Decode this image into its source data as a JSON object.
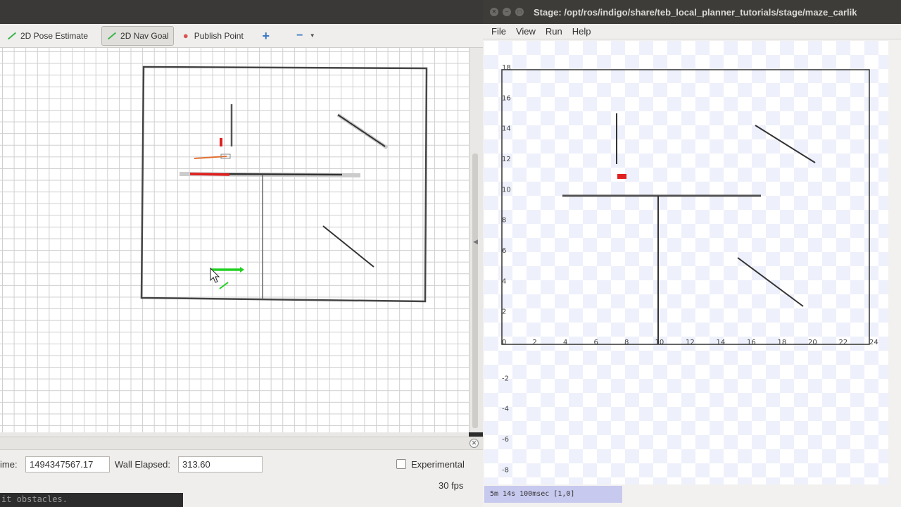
{
  "rviz": {
    "toolbar": {
      "pose_estimate": "2D Pose Estimate",
      "nav_goal": "2D Nav Goal",
      "publish_point": "Publish Point"
    },
    "timepanel": {
      "time_label": "ime:",
      "time_value": "1494347567.17",
      "wall_elapsed_label": "Wall Elapsed:",
      "wall_elapsed_value": "313.60",
      "experimental_label": "Experimental",
      "experimental_checked": false,
      "fps": "30 fps"
    },
    "terminal_snippet": "it obstacles."
  },
  "stage": {
    "title": "Stage: /opt/ros/indigo/share/teb_local_planner_tutorials/stage/maze_carlik",
    "menus": [
      "File",
      "View",
      "Run",
      "Help"
    ],
    "status": "5m 14s 100msec [1,0]",
    "x_ticks": [
      "0",
      "2",
      "4",
      "6",
      "8",
      "10",
      "12",
      "14",
      "16",
      "18",
      "20",
      "22",
      "24"
    ],
    "y_ticks_pos": [
      "18",
      "16",
      "14",
      "12",
      "10",
      "8",
      "6",
      "4",
      "2"
    ],
    "y_ticks_neg": [
      "-2",
      "-4",
      "-6",
      "-8"
    ]
  },
  "colors": {
    "robot": "#e02020",
    "goal_arrow": "#22d022",
    "wall": "#333333"
  }
}
